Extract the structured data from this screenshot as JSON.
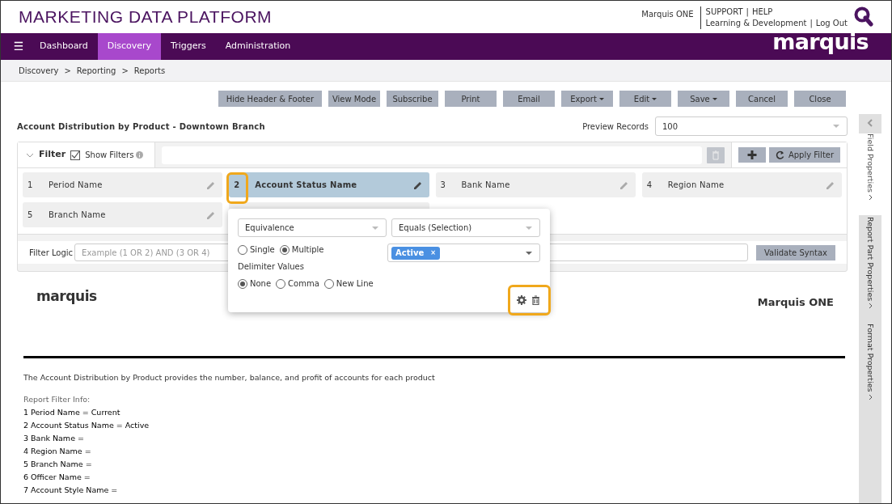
{
  "header": {
    "title": "MARKETING DATA PLATFORM",
    "user": "Marquis ONE",
    "links_top": [
      "SUPPORT",
      "HELP"
    ],
    "links_bottom": [
      "Learning & Development",
      "Log Out"
    ],
    "link_separator": "|"
  },
  "nav": {
    "menu_icon": "☰",
    "items": [
      {
        "label": "Dashboard",
        "selected": false
      },
      {
        "label": "Discovery",
        "selected": true
      },
      {
        "label": "Triggers",
        "selected": false
      },
      {
        "label": "Administration",
        "selected": false
      }
    ],
    "logo": "marquis"
  },
  "breadcrumb": {
    "separator": ">",
    "items": [
      "Discovery",
      "Reporting",
      "Reports"
    ]
  },
  "toolbar": [
    {
      "label": "Hide Header & Footer",
      "dropdown": false
    },
    {
      "label": "View Mode",
      "dropdown": false
    },
    {
      "label": "Subscribe",
      "dropdown": false
    },
    {
      "label": "Print",
      "dropdown": false
    },
    {
      "label": "Email",
      "dropdown": false
    },
    {
      "label": "Export",
      "dropdown": true
    },
    {
      "label": "Edit",
      "dropdown": true
    },
    {
      "label": "Save",
      "dropdown": true
    },
    {
      "label": "Cancel",
      "dropdown": false
    },
    {
      "label": "Close",
      "dropdown": false
    }
  ],
  "report_title": "Account Distribution by Product - Downtown Branch",
  "preview": {
    "label": "Preview Records",
    "value": "100"
  },
  "filter": {
    "label": "Filter",
    "show_filters": {
      "label": "Show Filters",
      "checked": true
    },
    "apply_label": "Apply Filter",
    "items": [
      {
        "kind": "filter",
        "number": "1",
        "label": "Period Name",
        "selected": false
      },
      {
        "kind": "filter",
        "number": "2",
        "label": "Account Status Name",
        "selected": true
      },
      {
        "kind": "filter",
        "number": "3",
        "label": "Bank Name",
        "selected": false
      },
      {
        "kind": "filter",
        "number": "4",
        "label": "Region Name",
        "selected": false
      },
      {
        "kind": "filter",
        "number": "5",
        "label": "Branch Name",
        "selected": false
      },
      {
        "kind": "covered",
        "selected": false
      }
    ],
    "logic": {
      "label": "Filter Logic",
      "placeholder": "Example (1 OR 2) AND (3 OR 4)",
      "validate_label": "Validate Syntax"
    }
  },
  "popup": {
    "operator_type": "Equivalence",
    "operator": "Equals (Selection)",
    "mode": [
      {
        "label": "Single",
        "selected": false
      },
      {
        "label": "Multiple",
        "selected": true
      }
    ],
    "values": [
      {
        "label": "Active",
        "remove": "×"
      }
    ],
    "delimiter_label": "Delimiter Values",
    "delimiter": [
      {
        "label": "None",
        "selected": true
      },
      {
        "label": "Comma",
        "selected": false
      },
      {
        "label": "New Line",
        "selected": false
      }
    ]
  },
  "report": {
    "logo": "marquis",
    "company": "Marquis ONE",
    "description": "The Account Distribution by Product provides the number, balance, and profit of accounts for each product",
    "filter_info_label": "Report Filter Info:",
    "filter_info": [
      "1 Period Name = Current",
      "2 Account Status Name = Active",
      "3 Bank Name =",
      "4 Region Name =",
      "5 Branch Name =",
      "6 Officer Name =",
      "7 Account Style Name ="
    ]
  },
  "side_tabs": [
    {
      "label": "Field Properties",
      "selected": true
    },
    {
      "label": "Report Part Properties",
      "selected": false
    },
    {
      "label": "Format Properties",
      "selected": false
    }
  ]
}
